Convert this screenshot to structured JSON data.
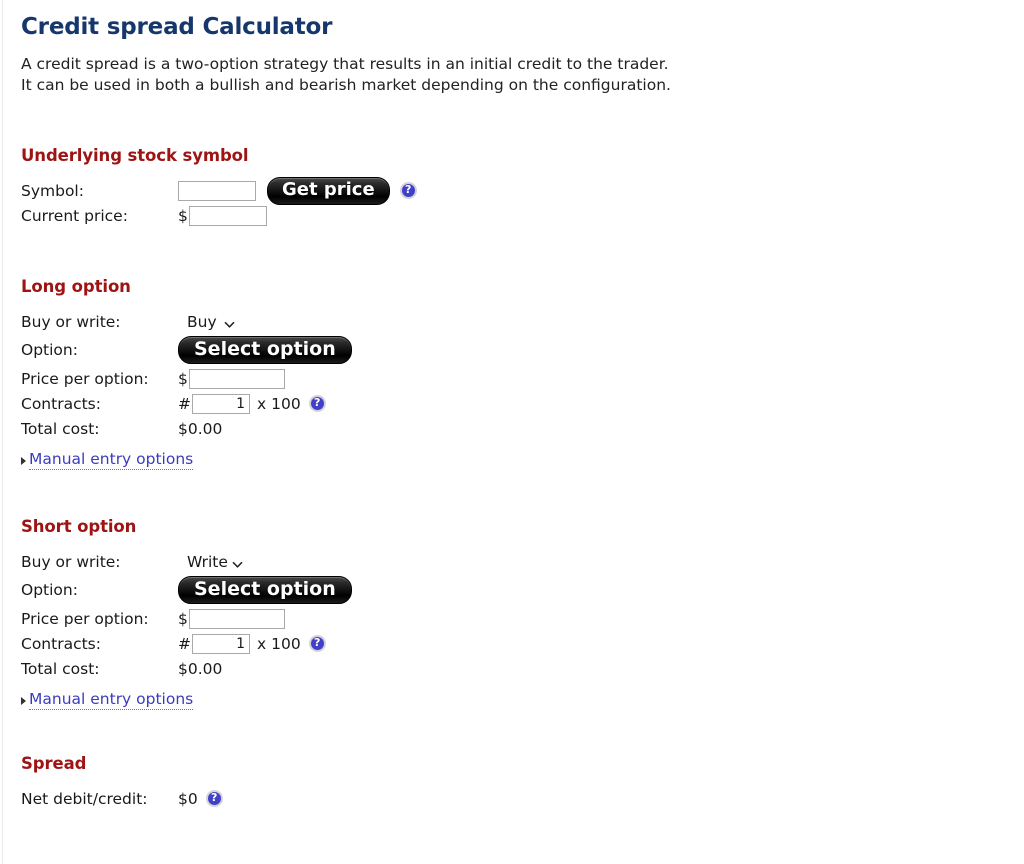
{
  "page": {
    "title": "Credit spread Calculator",
    "intro": "A credit spread is a two-option strategy that results in an initial credit to the trader. It can be used in both a bullish and bearish market depending on the configuration.",
    "title_color": "#16376b",
    "section_head_color": "#9e1313",
    "link_color": "#3b3bbf",
    "help_icon_color": "#4040c8"
  },
  "underlying": {
    "heading": "Underlying stock symbol",
    "symbol_label": "Symbol:",
    "symbol_value": "",
    "get_price_label": "Get price",
    "get_price_help": "help-icon",
    "current_price_label": "Current price:",
    "currency_prefix": "$",
    "current_price_value": ""
  },
  "long_option": {
    "heading": "Long option",
    "buy_or_write_label": "Buy or write:",
    "buy_or_write_value": "Buy",
    "buy_or_write_options": [
      "Buy",
      "Write"
    ],
    "option_label": "Option:",
    "select_option_label": "Select option",
    "price_per_option_label": "Price per option:",
    "currency_prefix": "$",
    "price_per_option_value": "",
    "contracts_label": "Contracts:",
    "contracts_prefix": "#",
    "contracts_value": "1",
    "contracts_multiplier": "x 100",
    "total_cost_label": "Total cost:",
    "total_cost_value": "$0.00",
    "manual_entry_label": "Manual entry options"
  },
  "short_option": {
    "heading": "Short option",
    "buy_or_write_label": "Buy or write:",
    "buy_or_write_value": "Write",
    "buy_or_write_options": [
      "Buy",
      "Write"
    ],
    "option_label": "Option:",
    "select_option_label": "Select option",
    "price_per_option_label": "Price per option:",
    "currency_prefix": "$",
    "price_per_option_value": "",
    "contracts_label": "Contracts:",
    "contracts_prefix": "#",
    "contracts_value": "1",
    "contracts_multiplier": "x 100",
    "total_cost_label": "Total cost:",
    "total_cost_value": "$0.00",
    "manual_entry_label": "Manual entry options"
  },
  "spread": {
    "heading": "Spread",
    "net_label": "Net debit/credit:",
    "net_value": "$0"
  }
}
